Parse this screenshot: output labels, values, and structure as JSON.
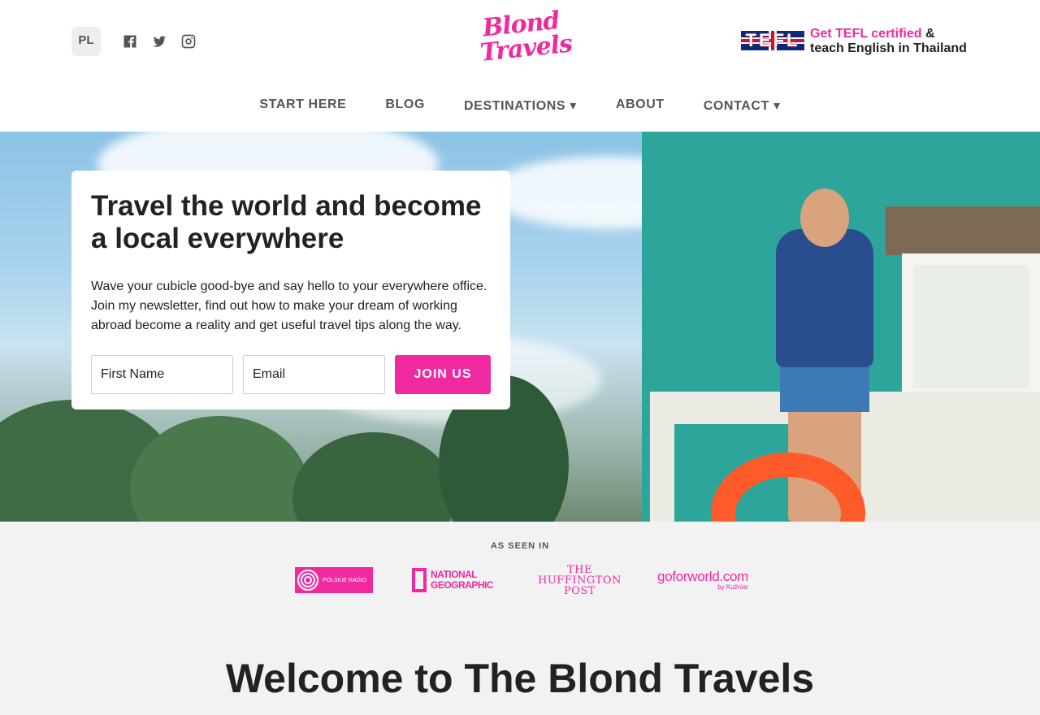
{
  "header": {
    "lang_label": "PL",
    "social_icons": [
      "facebook-icon",
      "twitter-icon",
      "instagram-icon"
    ],
    "logo": {
      "line1": "Blond",
      "line2": "Travels"
    },
    "banner": {
      "flag_word": "TEFL",
      "line1_pink": "Get TEFL certified",
      "line1_rest": " &",
      "line2": "teach English in Thailand"
    }
  },
  "nav": {
    "items": [
      {
        "label": "START HERE"
      },
      {
        "label": "BLOG"
      },
      {
        "label": "DESTINATIONS ▾"
      },
      {
        "label": "ABOUT"
      },
      {
        "label": "CONTACT ▾"
      }
    ]
  },
  "hero": {
    "title": "Travel the world and become a local everywhere",
    "text": "Wave your cubicle good-bye and say hello to your everywhere office. Join my newsletter, find out how to make your dream of working abroad become a reality and get useful travel tips along the way.",
    "first_name_placeholder": "First Name",
    "email_placeholder": "Email",
    "join_label": "JOIN US"
  },
  "press": {
    "title": "AS SEEN IN",
    "polskie_radio": "POLSKIE RADIO",
    "natgeo_line1": "NATIONAL",
    "natgeo_line2": "GEOGRAPHIC",
    "huffpost_line1": "THE",
    "huffpost_line2": "HUFFINGTON",
    "huffpost_line3": "POST",
    "goforworld_main": "goforworld.com",
    "goforworld_sub": "by Kuźniar"
  },
  "welcome": {
    "title": "Welcome to The Blond Travels"
  },
  "colors": {
    "accent": "#f0299f",
    "text": "#222222",
    "muted": "#555555"
  }
}
